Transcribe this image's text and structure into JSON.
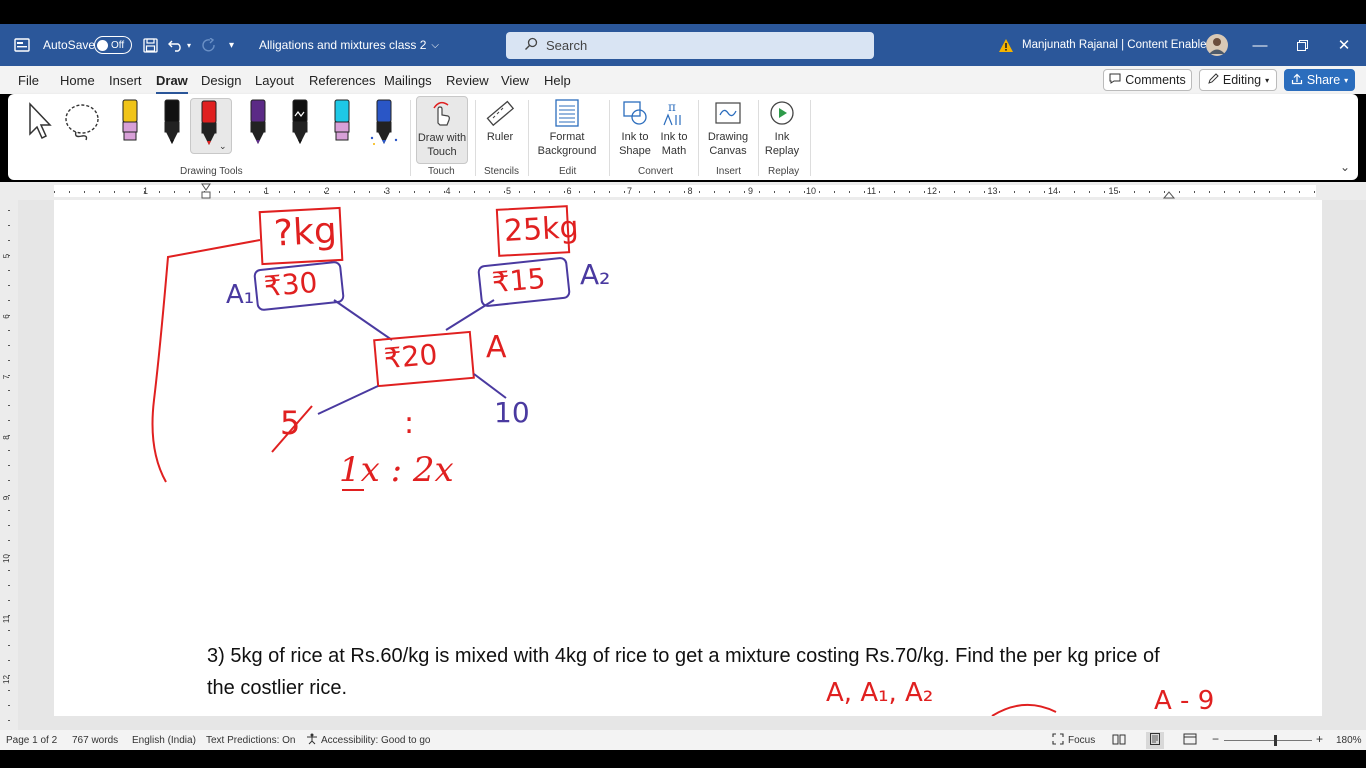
{
  "titlebar": {
    "autosave_label": "AutoSave",
    "autosave_state": "Off",
    "doc_title": "Alligations and mixtures class 2",
    "search_placeholder": "Search",
    "user_name": "Manjunath Rajanal | Content Enablers"
  },
  "menu": {
    "tabs": [
      "File",
      "Home",
      "Insert",
      "Draw",
      "Design",
      "Layout",
      "References",
      "Mailings",
      "Review",
      "View",
      "Help"
    ],
    "active_tab": "Draw",
    "comments_label": "Comments",
    "editing_label": "Editing",
    "share_label": "Share"
  },
  "ribbon": {
    "buttons": {
      "draw_with_touch": "Draw with Touch",
      "ruler": "Ruler",
      "format_background": "Format Background",
      "ink_to_shape": "Ink to Shape",
      "ink_to_math": "Ink to Math",
      "drawing_canvas": "Drawing Canvas",
      "ink_replay": "Ink Replay"
    },
    "groups": {
      "drawing_tools": "Drawing Tools",
      "touch": "Touch",
      "stencils": "Stencils",
      "edit": "Edit",
      "convert": "Convert",
      "insert": "Insert",
      "replay": "Replay"
    },
    "pen_colors": [
      "#f0c419",
      "#111111",
      "#e02020",
      "#5b2a86",
      "#111111",
      "#1ec8e6",
      "#2a56c6"
    ]
  },
  "ruler": {
    "h_ticks": [
      "1",
      "1",
      "2",
      "3",
      "4",
      "5",
      "6",
      "7",
      "8",
      "9",
      "10",
      "11",
      "12",
      "13",
      "14",
      "15"
    ],
    "v_ticks": [
      "5",
      "6",
      "7",
      "8",
      "9",
      "10",
      "11",
      "12"
    ]
  },
  "document": {
    "question": "3) 5kg of rice at Rs.60/kg is mixed with 4kg of rice to get a mixture costing Rs.70/kg. Find the per kg price of the costlier rice.",
    "ink": {
      "qty_left": "?kg",
      "qty_right": "25kg",
      "price_left": "₹30",
      "price_right": "₹15",
      "price_mix": "₹20",
      "label_a1": "A₁",
      "label_a2": "A₂",
      "label_a": "A",
      "diff_left": "5",
      "diff_right": "10",
      "colon": ":",
      "ratio": "1x : 2x",
      "bottom_note": "A, A₁, A₂",
      "bottom_right": "A - 9"
    }
  },
  "status": {
    "page": "Page 1 of 2",
    "words": "767 words",
    "language": "English (India)",
    "text_predictions": "Text Predictions: On",
    "accessibility": "Accessibility: Good to go",
    "focus": "Focus",
    "zoom": "180%"
  },
  "colors": {
    "word_blue": "#2b579a",
    "ink_red": "#e02020",
    "ink_purple": "#4a3aa0"
  }
}
